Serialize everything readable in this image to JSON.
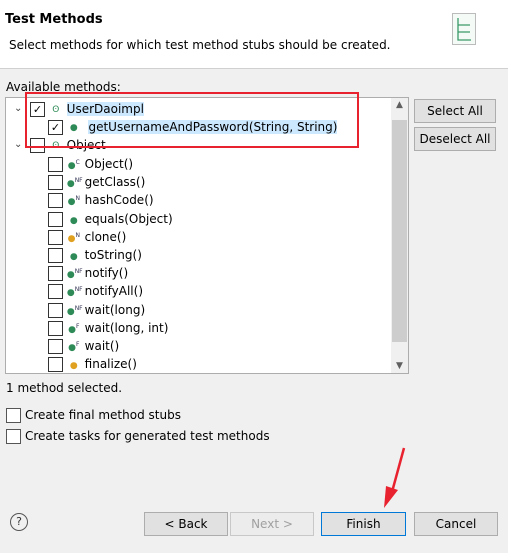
{
  "header": {
    "title": "Test Methods",
    "description": "Select methods for which test method stubs should be created.",
    "icon": "test-methods-banner-icon"
  },
  "tree": {
    "label": "Available methods:",
    "class1": {
      "name": "UserDaoimpl",
      "checked": true,
      "methods": [
        {
          "name": "getUsernameAndPassword(String, String)",
          "checked": true,
          "modifier": ""
        }
      ]
    },
    "class2": {
      "name": "Object",
      "checked": false,
      "methods": [
        {
          "name": "Object()",
          "mod": "C",
          "color": "#2e8b57"
        },
        {
          "name": "getClass()",
          "mod": "NF",
          "color": "#2e8b57"
        },
        {
          "name": "hashCode()",
          "mod": "N",
          "color": "#2e8b57"
        },
        {
          "name": "equals(Object)",
          "mod": "",
          "color": "#2e8b57"
        },
        {
          "name": "clone()",
          "mod": "N",
          "color": "#e0a020"
        },
        {
          "name": "toString()",
          "mod": "",
          "color": "#2e8b57"
        },
        {
          "name": "notify()",
          "mod": "NF",
          "color": "#2e8b57"
        },
        {
          "name": "notifyAll()",
          "mod": "NF",
          "color": "#2e8b57"
        },
        {
          "name": "wait(long)",
          "mod": "NF",
          "color": "#2e8b57"
        },
        {
          "name": "wait(long, int)",
          "mod": "F",
          "color": "#2e8b57"
        },
        {
          "name": "wait()",
          "mod": "F",
          "color": "#2e8b57"
        },
        {
          "name": "finalize()",
          "mod": "",
          "color": "#e0a020"
        }
      ]
    }
  },
  "buttons": {
    "select_all": "Select All",
    "deselect_all": "Deselect All",
    "back": "< Back",
    "next": "Next >",
    "finish": "Finish",
    "cancel": "Cancel"
  },
  "status": "1 method selected.",
  "options": [
    {
      "label": "Create final method stubs",
      "checked": false
    },
    {
      "label": "Create tasks for generated test methods",
      "checked": false
    }
  ],
  "annotation_color": "#e8232f"
}
